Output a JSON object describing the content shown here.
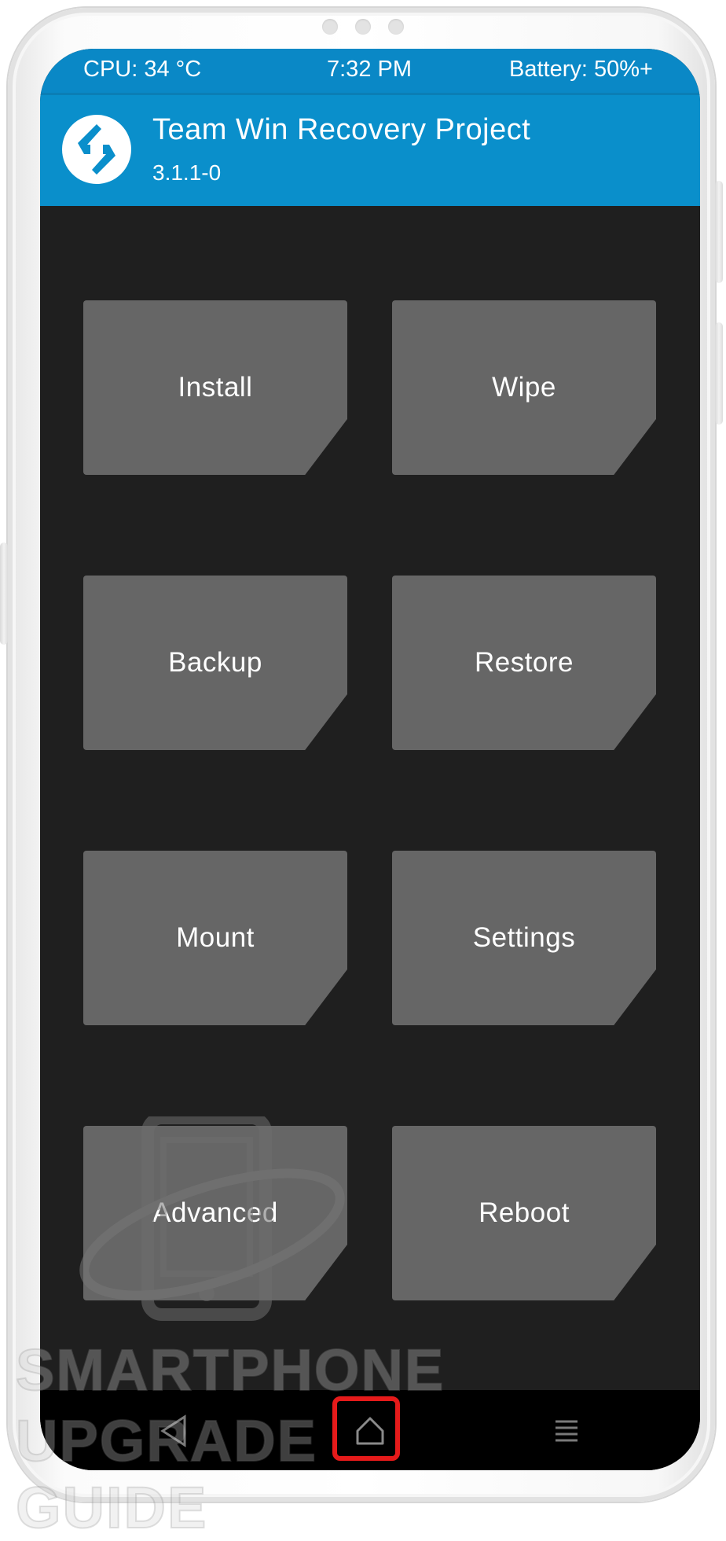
{
  "status_bar": {
    "cpu": "CPU: 34 °C",
    "time": "7:32 PM",
    "battery": "Battery: 50%+"
  },
  "header": {
    "title": "Team Win Recovery Project",
    "version": "3.1.1-0",
    "logo_icon": "twrp-logo-icon"
  },
  "menu": {
    "tiles": [
      {
        "label": "Install"
      },
      {
        "label": "Wipe"
      },
      {
        "label": "Backup"
      },
      {
        "label": "Restore"
      },
      {
        "label": "Mount"
      },
      {
        "label": "Settings"
      },
      {
        "label": "Advanced"
      },
      {
        "label": "Reboot"
      }
    ]
  },
  "nav": {
    "back_icon": "back-triangle-icon",
    "home_icon": "home-icon",
    "menu_icon": "menu-lines-icon",
    "highlighted": "home"
  },
  "watermark": {
    "line1": "SMARTPHONE",
    "line2": "UPGRADE GUIDE"
  },
  "colors": {
    "header": "#0a8fcb",
    "status_bar": "#0a88c6",
    "background": "#1f1f1f",
    "tile": "#666666",
    "highlight": "#e61a1a"
  }
}
